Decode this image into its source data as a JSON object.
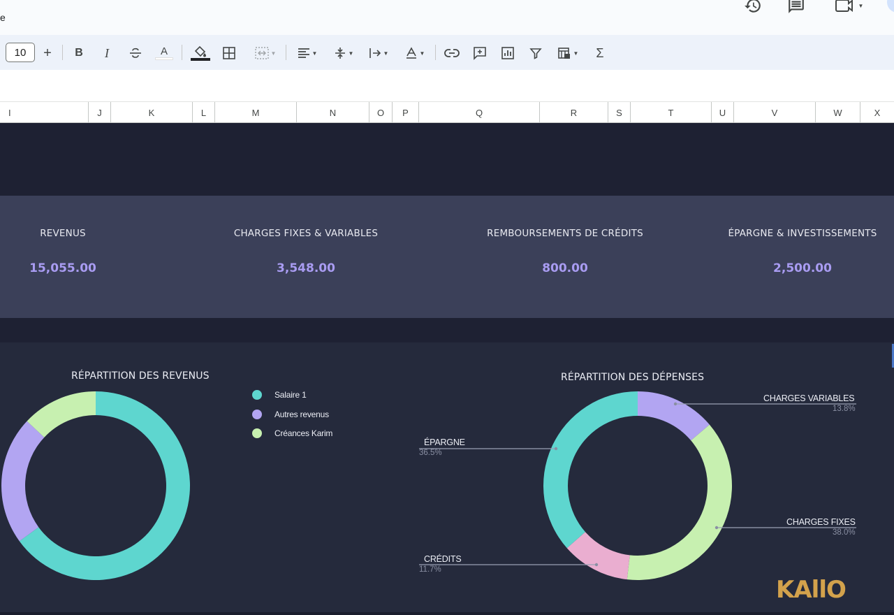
{
  "topbar": {
    "stub_text": "e",
    "icons": [
      "history-icon",
      "comment-icon",
      "meet-icon"
    ]
  },
  "toolbar": {
    "font_size": "10",
    "plus": "+",
    "bold": "B",
    "italic": "I",
    "text_color": "A",
    "sum": "Σ"
  },
  "columns": [
    "I",
    "J",
    "K",
    "L",
    "M",
    "N",
    "O",
    "P",
    "Q",
    "R",
    "S",
    "T",
    "U",
    "V",
    "W",
    "X"
  ],
  "kpis": [
    {
      "label": "REVENUS",
      "value": "15,055.00"
    },
    {
      "label": "CHARGES FIXES &  VARIABLES",
      "value": "3,548.00"
    },
    {
      "label": "REMBOURSEMENTS DE CRÉDITS",
      "value": "800.00"
    },
    {
      "label": "ÉPARGNE & INVESTISSEMENTS",
      "value": "2,500.00"
    }
  ],
  "chart_data": [
    {
      "type": "pie",
      "donut": true,
      "title": "RÉPARTITION DES REVENUS",
      "legend_position": "right",
      "series": [
        {
          "name": "Salaire 1",
          "value": 0.65,
          "color": "#5ed6cf"
        },
        {
          "name": "Autres revenus",
          "value": 0.22,
          "color": "#b2a5f2"
        },
        {
          "name": "Créances Karim",
          "value": 0.13,
          "color": "#c7f0b0"
        }
      ]
    },
    {
      "type": "pie",
      "donut": true,
      "title": "RÉPARTITION DES DÉPENSES",
      "legend_position": "callouts",
      "series": [
        {
          "name": "CHARGES VARIABLES",
          "label": "13.8%",
          "value": 13.8,
          "color": "#b2a5f2"
        },
        {
          "name": "CHARGES FIXES",
          "label": "38.0%",
          "value": 38.0,
          "color": "#c7f0b0"
        },
        {
          "name": "CRÉDITS",
          "label": "11.7%",
          "value": 11.7,
          "color": "#eaaed0"
        },
        {
          "name": "ÉPARGNE",
          "label": "36.5%",
          "value": 36.5,
          "color": "#5ed6cf"
        }
      ]
    }
  ],
  "logo": "KAllO",
  "colors": {
    "sheet_bg": "#1e2133",
    "kpi_band": "#3b4059",
    "charts_panel": "#252a3c",
    "kpi_value": "#a99cf2"
  }
}
